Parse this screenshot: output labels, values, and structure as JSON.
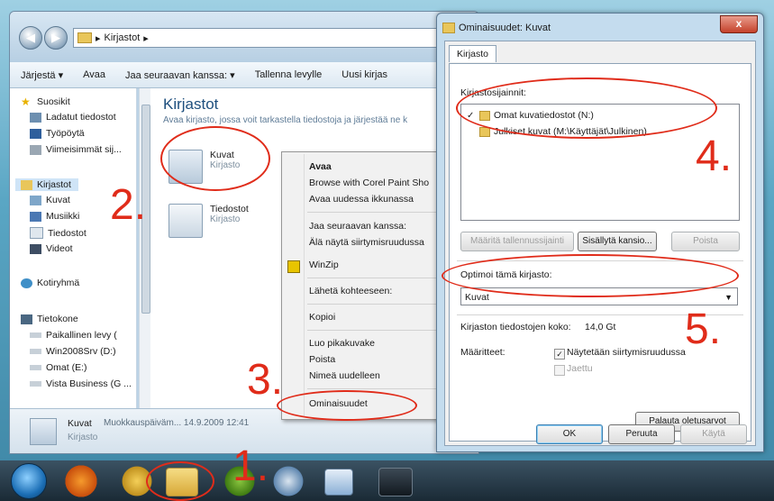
{
  "explorer": {
    "address_parts": [
      "Kirjastot",
      "▸"
    ],
    "toolbar": [
      "Järjestä ▾",
      "Avaa",
      "Jaa seuraavan kanssa: ▾",
      "Tallenna levylle",
      "Uusi kirjas"
    ],
    "nav": {
      "favorites": "Suosikit",
      "fav_items": [
        "Ladatut tiedostot",
        "Työpöytä",
        "Viimeisimmät sij..."
      ],
      "libraries": "Kirjastot",
      "lib_items": [
        "Kuvat",
        "Musiikki",
        "Tiedostot",
        "Videot"
      ],
      "homegroup": "Kotiryhmä",
      "computer": "Tietokone",
      "drives": [
        "Paikallinen levy (",
        "Win2008Srv (D:)",
        "Omat (E:)",
        "Vista Business (G ..."
      ]
    },
    "content": {
      "title": "Kirjastot",
      "subtitle": "Avaa kirjasto, jossa voit tarkastella tiedostoja ja järjestää ne k",
      "tiles": [
        {
          "name": "Kuvat",
          "kind": "Kirjasto"
        },
        {
          "name": "Tiedostot",
          "kind": "Kirjasto"
        }
      ]
    },
    "status": {
      "name": "Kuvat",
      "modified": "Muokkauspäiväm... 14.9.2009 12:41",
      "kind": "Kirjasto"
    }
  },
  "context_menu": {
    "items": [
      "Avaa",
      "Browse with Corel Paint Sho",
      "Avaa uudessa ikkunassa",
      "Jaa seuraavan kanssa:",
      "Älä näytä siirtymisruudussa",
      "WinZip",
      "Lähetä kohteeseen:",
      "Kopioi",
      "Luo pikakuvake",
      "Poista",
      "Nimeä uudelleen",
      "Ominaisuudet"
    ]
  },
  "dialog": {
    "title": "Ominaisuudet: Kuvat",
    "close": "x",
    "tab": "Kirjasto",
    "locations_label": "Kirjastosijainnit:",
    "locations": [
      {
        "check": "✓",
        "name": "Omat kuvatiedostot (N:)"
      },
      {
        "check": "",
        "name": "Julkiset kuvat (M:\\Käyttäjät\\Julkinen)"
      }
    ],
    "buttons": {
      "set_save": "Määritä tallennussijainti",
      "include": "Sisällytä kansio...",
      "remove": "Poista"
    },
    "optimize_label": "Optimoi tämä kirjasto:",
    "optimize_value": "Kuvat",
    "size_label": "Kirjaston tiedostojen koko:",
    "size_value": "14,0 Gt",
    "attrs_label": "Määritteet:",
    "attr_shown": "Näytetään siirtymisruudussa",
    "attr_shared": "Jaettu",
    "restore": "Palauta oletusarvot",
    "ok": "OK",
    "cancel": "Peruuta",
    "apply": "Käytä"
  },
  "annotations": {
    "n1": "1.",
    "n2": "2.",
    "n3": "3.",
    "n4": "4.",
    "n5": "5."
  },
  "colors": {
    "annotation": "#e02c1a",
    "accent": "#1e4f7e"
  }
}
